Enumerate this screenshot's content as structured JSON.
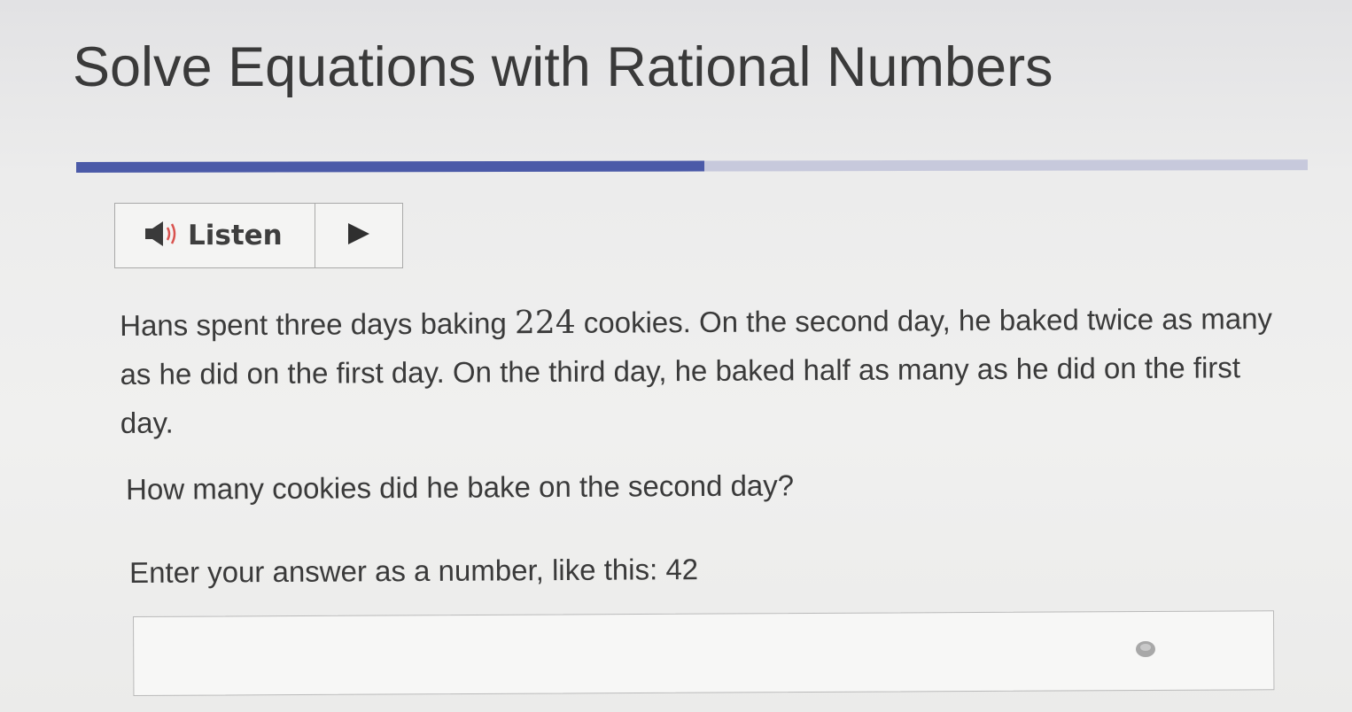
{
  "page": {
    "title": "Solve Equations with Rational Numbers"
  },
  "progress": {
    "fraction": 0.51
  },
  "listen": {
    "label": "Listen",
    "speaker_icon": "speaker-icon",
    "play_icon": "play-icon"
  },
  "question": {
    "part1": "Hans spent three days baking ",
    "number": "224",
    "part2": " cookies. On the second day, he baked twice as many as he did on the first day. On the third day, he baked half as many as he did on the first day.",
    "prompt": "How many cookies did he bake on the second day?",
    "instructions": "Enter your answer as a number, like this: 42"
  },
  "answer": {
    "value": "",
    "placeholder": ""
  },
  "colors": {
    "progress_fill": "#4b5aa8",
    "progress_track": "#c7c9dc",
    "speaker_accent": "#d9534f"
  }
}
